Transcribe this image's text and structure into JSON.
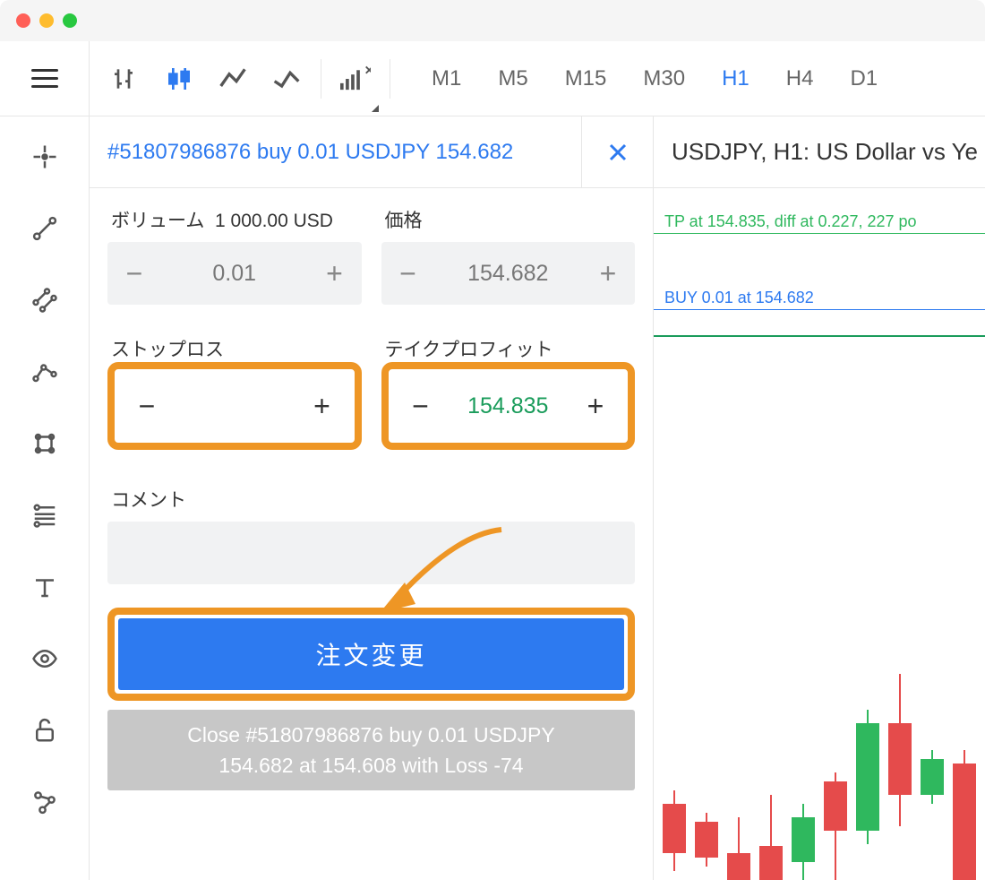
{
  "timeframes": [
    "M1",
    "M5",
    "M15",
    "M30",
    "H1",
    "H4",
    "D1"
  ],
  "timeframe_active": "H1",
  "order": {
    "title": "#51807986876 buy 0.01 USDJPY 154.682",
    "volume_label": "ボリューム",
    "volume_units": "1 000.00 USD",
    "volume_value": "0.01",
    "price_label": "価格",
    "price_value": "154.682",
    "stoploss_label": "ストップロス",
    "stoploss_value": "",
    "takeprofit_label": "テイクプロフィット",
    "takeprofit_value": "154.835",
    "comment_label": "コメント",
    "submit_label": "注文変更",
    "close_text_line1": "Close #51807986876 buy 0.01 USDJPY",
    "close_text_line2": "154.682 at 154.608 with Loss -74"
  },
  "chart": {
    "title": "USDJPY, H1: US Dollar vs Ye",
    "tp_line": "TP at 154.835, diff at 0.227, 227 po",
    "buy_line": "BUY 0.01 at 154.682"
  }
}
